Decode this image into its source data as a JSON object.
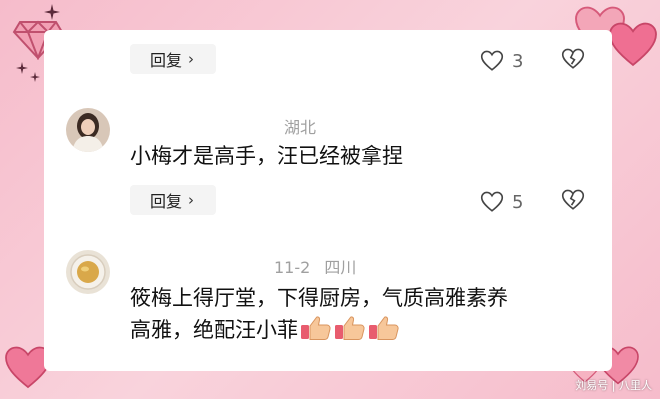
{
  "comments": [
    {
      "reply_label": "回复",
      "like_count": "3"
    },
    {
      "location": "湖北",
      "text": "小梅才是高手，汪已经被拿捏",
      "reply_label": "回复",
      "like_count": "5"
    },
    {
      "date": "11-2",
      "location": "四川",
      "text_line1": "筱梅上得厅堂，下得厨房，气质高雅素养",
      "text_line2": "高雅，绝配汪小菲"
    }
  ],
  "watermark": "刘易号 | 八里人",
  "colors": {
    "frame_pink": "#f7c6cf",
    "heart_pink": "#f07c9a",
    "card_bg": "#ffffff",
    "reply_bg": "#f4f4f4"
  },
  "icons": [
    "diamond-icon",
    "sparkle-icon",
    "heart-icon",
    "broken-heart-icon",
    "thumbs-up-icon",
    "chevron-right-icon"
  ]
}
